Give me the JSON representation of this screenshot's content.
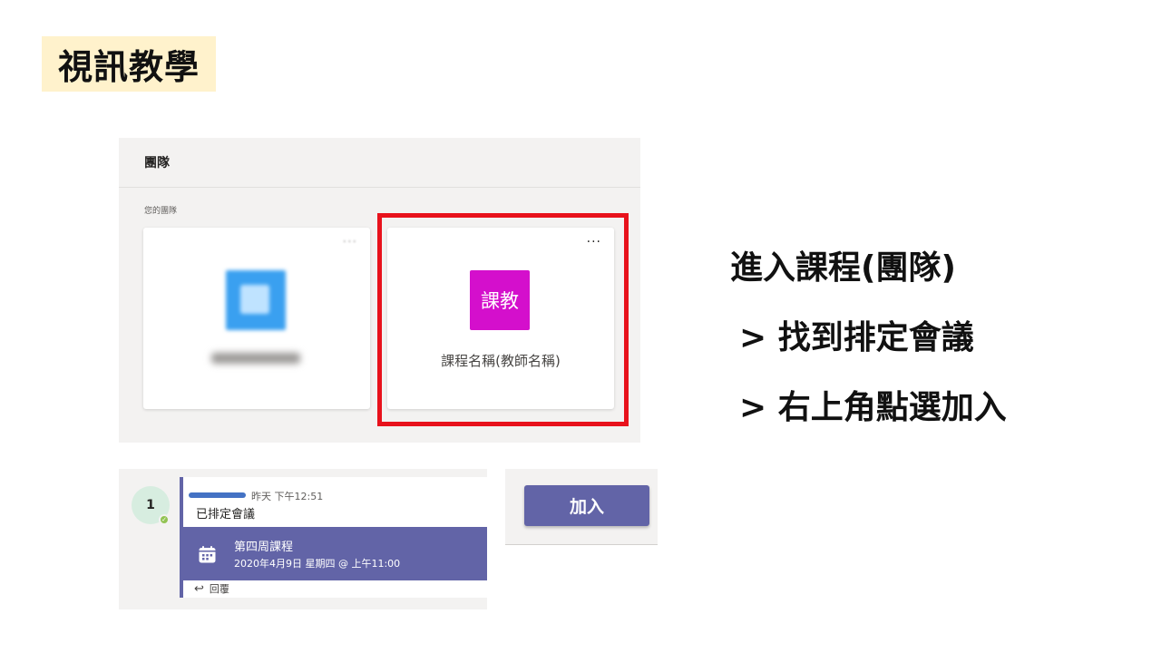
{
  "slide": {
    "title": "視訊教學"
  },
  "teams_panel": {
    "header": "團隊",
    "section_label": "您的團隊",
    "cards": [
      {
        "icon": "more-icon",
        "avatar_color": "#3aa0f0",
        "name_redacted": true
      },
      {
        "icon": "more-icon",
        "more": "···",
        "avatar_text": "課教",
        "avatar_color": "#d40fcc",
        "name": "課程名稱(教師名稱)"
      }
    ],
    "highlight_color": "#e8121c"
  },
  "instructions": [
    "進入課程(團隊)",
    "> 找到排定會議",
    "> 右上角點選加入"
  ],
  "chat": {
    "avatar_label": "1",
    "time": "昨天 下午12:51",
    "message": "已排定會議",
    "meeting": {
      "icon": "calendar-icon",
      "title": "第四周課程",
      "date": "2020年4月9日 星期四 @ 上午11:00"
    },
    "reply_icon": "reply-icon",
    "reply": "回覆"
  },
  "join": {
    "label": "加入",
    "color": "#6264a7"
  }
}
